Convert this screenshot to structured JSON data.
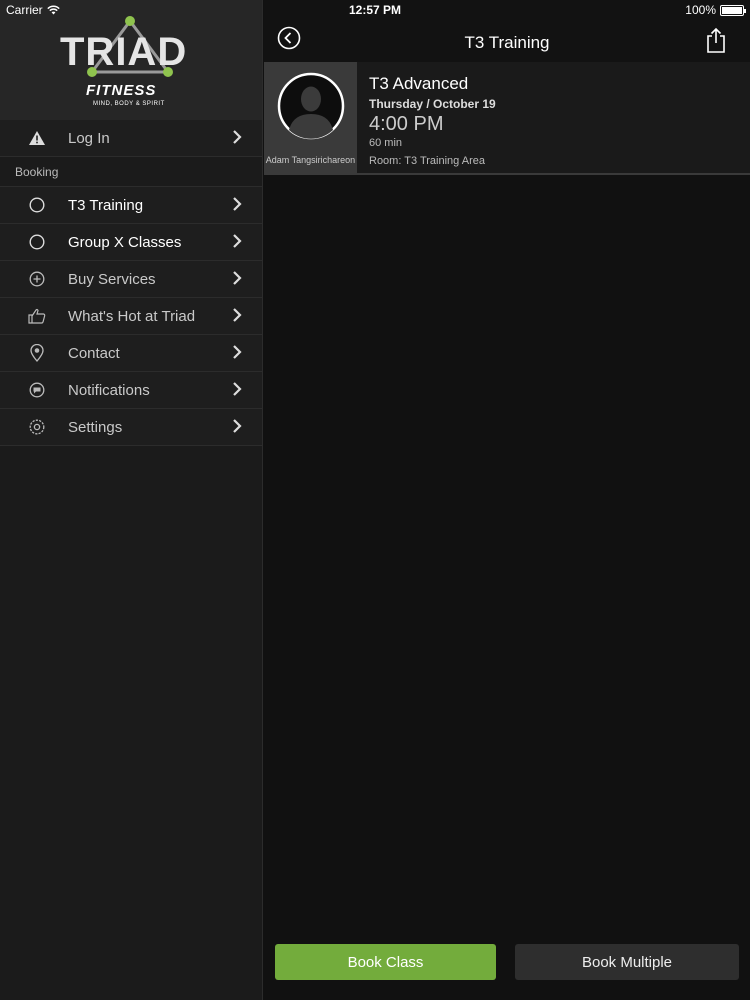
{
  "status": {
    "carrier": "Carrier",
    "time": "12:57 PM",
    "battery": "100%"
  },
  "brand": {
    "logo_word": "TRIAD",
    "logo_sub": "FITNESS",
    "logo_tagline": "MIND, BODY & SPIRIT",
    "accent": "#73ac3c"
  },
  "sidebar": {
    "login_label": "Log In",
    "section_label": "Booking",
    "items": [
      {
        "label": "T3 Training",
        "icon": "circle-icon"
      },
      {
        "label": "Group X Classes",
        "icon": "circle-icon"
      },
      {
        "label": "Buy Services",
        "icon": "plus-circle-icon"
      },
      {
        "label": "What's Hot at Triad",
        "icon": "thumbs-up-icon"
      },
      {
        "label": "Contact",
        "icon": "map-pin-icon"
      },
      {
        "label": "Notifications",
        "icon": "chat-bubble-icon"
      },
      {
        "label": "Settings",
        "icon": "gear-icon"
      }
    ]
  },
  "nav": {
    "title": "T3 Training"
  },
  "class_card": {
    "instructor": "Adam Tangsirichareon",
    "name": "T3 Advanced",
    "date": "Thursday / October 19",
    "time": "4:00 PM",
    "duration": "60 min",
    "room": "Room: T3 Training Area"
  },
  "actions": {
    "book_class": "Book Class",
    "book_multiple": "Book Multiple"
  }
}
